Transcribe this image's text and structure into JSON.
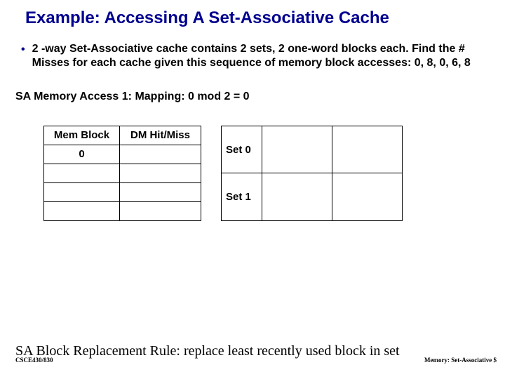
{
  "title": "Example: Accessing A Set-Associative Cache",
  "bullet": "2 -way Set-Associative cache contains 2 sets, 2 one-word blocks each. Find the # Misses for each cache given this sequence of memory block accesses: 0, 8, 0, 6, 8",
  "subhead": "SA Memory Access 1:  Mapping: 0 mod 2 = 0",
  "table1": {
    "headers": [
      "Mem Block",
      "DM Hit/Miss"
    ],
    "rows": [
      [
        "0",
        ""
      ],
      [
        "",
        ""
      ],
      [
        "",
        ""
      ],
      [
        "",
        ""
      ]
    ]
  },
  "table2": {
    "rows": [
      [
        "Set 0",
        "",
        ""
      ],
      [
        "Set 1",
        "",
        ""
      ]
    ]
  },
  "bottom_rule": "SA Block Replacement Rule: replace least recently used block in set",
  "footer_left": "CSCE430/830",
  "footer_right": "Memory: Set-Associative $"
}
